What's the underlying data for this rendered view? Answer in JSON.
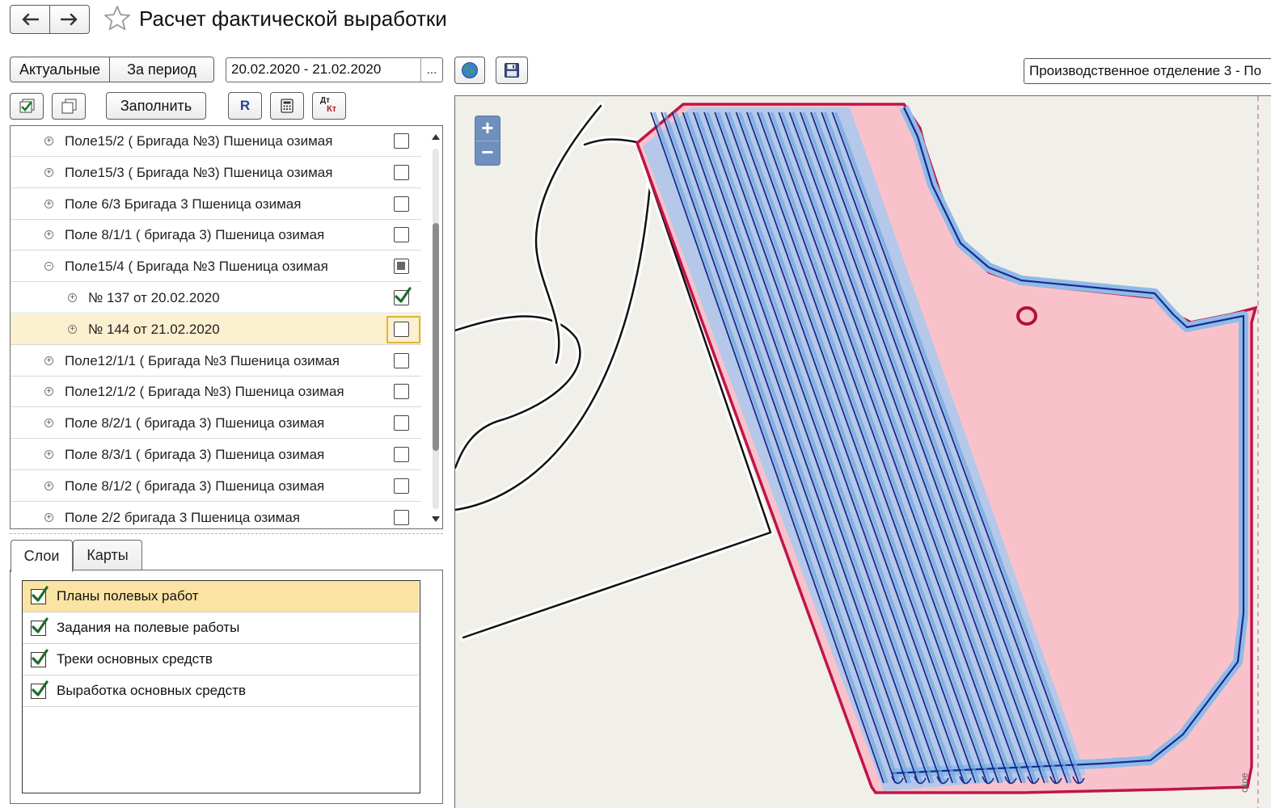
{
  "header": {
    "title": "Расчет фактической выработки",
    "back_icon": "arrow-left-icon",
    "forward_icon": "arrow-right-icon",
    "favorite_icon": "star-icon"
  },
  "toolbar": {
    "actual_label": "Актуальные",
    "period_label": "За период",
    "date_range": "20.02.2020 - 21.02.2020",
    "select_button": "...",
    "fill_label": "Заполнить",
    "r_label": "R",
    "dt_label": "Дт",
    "kt_label": "Кт",
    "organization": "Производственное отделение 3 - По"
  },
  "tree": {
    "rows": [
      {
        "label": "Поле15/2 ( Бригада №3) Пшеница озимая",
        "level": 0,
        "expander": "+",
        "checked": "no"
      },
      {
        "label": "Поле15/3 ( Бригада №3) Пшеница озимая",
        "level": 0,
        "expander": "+",
        "checked": "no"
      },
      {
        "label": "Поле 6/3 Бригада 3 Пшеница озимая",
        "level": 0,
        "expander": "+",
        "checked": "no"
      },
      {
        "label": "Поле 8/1/1 ( бригада 3) Пшеница озимая",
        "level": 0,
        "expander": "+",
        "checked": "no"
      },
      {
        "label": "Поле15/4 ( Бригада №3 Пшеница озимая",
        "level": 0,
        "expander": "−",
        "checked": "partial"
      },
      {
        "label": "№ 137 от 20.02.2020",
        "level": 1,
        "expander": "+",
        "checked": "yes"
      },
      {
        "label": "№ 144 от 21.02.2020",
        "level": 1,
        "expander": "+",
        "checked": "no",
        "selected": true
      },
      {
        "label": "Поле12/1/1 ( Бригада №3 Пшеница озимая",
        "level": 0,
        "expander": "+",
        "checked": "no"
      },
      {
        "label": "Поле12/1/2 ( Бригада №3)  Пшеница озимая",
        "level": 0,
        "expander": "+",
        "checked": "no"
      },
      {
        "label": "Поле 8/2/1 ( бригада 3) Пшеница озимая",
        "level": 0,
        "expander": "+",
        "checked": "no"
      },
      {
        "label": "Поле 8/3/1 ( бригада 3) Пшеница озимая",
        "level": 0,
        "expander": "+",
        "checked": "no"
      },
      {
        "label": "Поле 8/1/2 ( бригада 3) Пшеница озимая",
        "level": 0,
        "expander": "+",
        "checked": "no"
      },
      {
        "label": "Поле 2/2 бригада 3 Пшеница озимая",
        "level": 0,
        "expander": "+",
        "checked": "no"
      }
    ]
  },
  "tabs": [
    {
      "label": "Слои",
      "active": true
    },
    {
      "label": "Карты",
      "active": false
    }
  ],
  "layers": [
    {
      "label": "Планы полевых работ",
      "checked": true,
      "selected": true
    },
    {
      "label": "Задания на полевые работы",
      "checked": true,
      "selected": false
    },
    {
      "label": "Треки основных средств",
      "checked": true,
      "selected": false
    },
    {
      "label": "Выработка основных средств",
      "checked": true,
      "selected": false
    }
  ],
  "map": {
    "zoom_in": "+",
    "zoom_out": "−",
    "edge_label": "ское",
    "colors": {
      "background": "#f1efe9",
      "field_fill": "#f9c2cb",
      "field_border": "#c0144a",
      "track_dark": "#1a2a8c",
      "track_light": "#7fb3e6",
      "road": "#111111"
    }
  }
}
